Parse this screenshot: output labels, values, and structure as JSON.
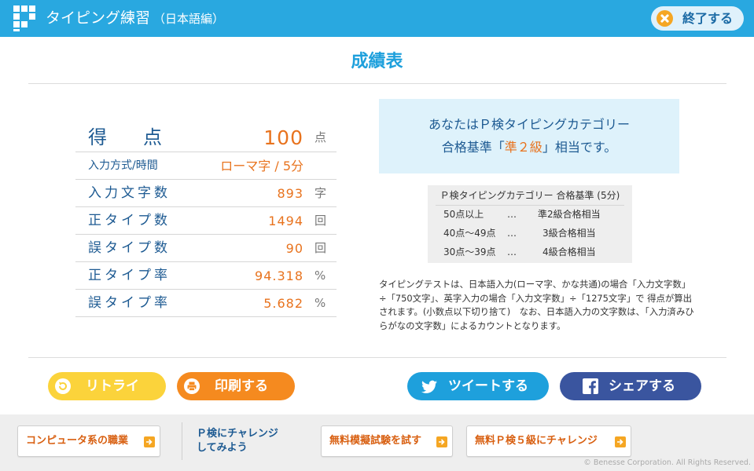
{
  "header": {
    "title": "タイピング練習",
    "subtitle": "（日本語編）",
    "exit_label": "終了する"
  },
  "page_title": "成績表",
  "score": {
    "main_label_chars": [
      "得",
      "点"
    ],
    "main_value": "100",
    "main_unit": "点",
    "rows": [
      {
        "label": "入力方式/時間",
        "value": "ローマ字 / 5分",
        "unit": ""
      },
      {
        "label": "入力文字数",
        "value": "893",
        "unit": "字"
      },
      {
        "label": "正タイプ数",
        "value": "1494",
        "unit": "回"
      },
      {
        "label": "誤タイプ数",
        "value": "90",
        "unit": "回"
      },
      {
        "label": "正タイプ率",
        "value": "94.318",
        "unit": "%"
      },
      {
        "label": "誤タイプ率",
        "value": "5.682",
        "unit": "%"
      }
    ]
  },
  "result": {
    "line1": "あなたはＰ検タイピングカテゴリー",
    "line2_prefix": "合格基準「",
    "line2_highlight": "準２級",
    "line2_suffix": "」相当です。"
  },
  "criteria": {
    "header": "Ｐ検タイピングカテゴリー 合格基準 (5分)",
    "rows": [
      {
        "range": "50点以上",
        "sep": "…",
        "grade": "準2級合格相当"
      },
      {
        "range": "40点～49点",
        "sep": "…",
        "grade": "3級合格相当"
      },
      {
        "range": "30点～39点",
        "sep": "…",
        "grade": "4級合格相当"
      }
    ]
  },
  "note": "タイピングテストは、日本語入力(ローマ字、かな共通)の場合「入力文字数」÷「750文字」、英字入力の場合「入力文字数」÷「1275文字」で 得点が算出されます。(小数点以下切り捨て)　なお、日本語入力の文字数は、「入力済みひらがなの文字数」によるカウントとなります。",
  "actions": {
    "retry": "リトライ",
    "print": "印刷する",
    "tweet": "ツイートする",
    "share": "シェアする"
  },
  "footer": {
    "careers": "コンピュータ系の職業",
    "challenge_line1": "Ｐ検にチャレンジ",
    "challenge_line2": "してみよう",
    "mock_exam": "無料模擬試験を試す",
    "grade5": "無料Ｐ検５級にチャレンジ",
    "copyright": "© Benesse Corporation. All Rights Reserved."
  },
  "colors": {
    "header_bg": "#29a8e0",
    "accent_orange": "#e8731e",
    "text_navy": "#1d5a92",
    "retry_yellow": "#fbd33b",
    "print_orange": "#f58a1f",
    "twitter_blue": "#1ea0dc",
    "facebook_blue": "#3a559f"
  }
}
